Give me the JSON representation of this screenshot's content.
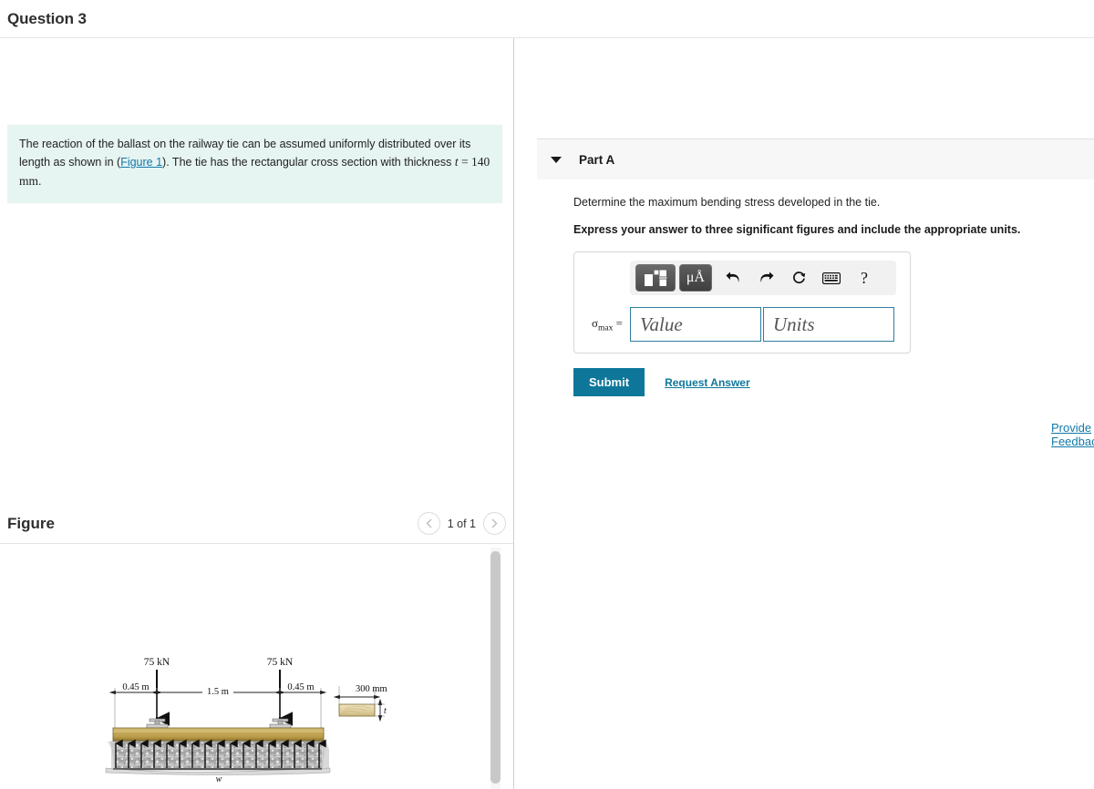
{
  "question": {
    "title": "Question 3"
  },
  "problem": {
    "text_part1": "The reaction of the ballast on the railway tie can be assumed uniformly distributed over its length as shown in (",
    "figure_link": "Figure 1",
    "text_part2": "). The tie has the rectangular cross section with thickness ",
    "thickness_var": "t",
    "thickness_eq": " = ",
    "thickness_value": "140 mm",
    "text_end": "."
  },
  "figure_panel": {
    "label": "Figure",
    "counter": "1 of 1",
    "prev_icon": "chevron-left-icon",
    "next_icon": "chevron-right-icon"
  },
  "figure_art": {
    "load_left_label": "75 kN",
    "load_right_label": "75 kN",
    "dim_left": "0.45 m",
    "dim_center": "1.5 m",
    "dim_right": "0.45 m",
    "distributed_load_label": "w",
    "section_width_label": "300 mm",
    "section_thickness_label": "t"
  },
  "part_a": {
    "caret_icon": "caret-down-icon",
    "label": "Part A",
    "prompt": "Determine the maximum bending stress developed in the tie.",
    "instruction": "Express your answer to three significant figures and include the appropriate units.",
    "toolbar": {
      "template_icon": "math-template-icon",
      "units_icon": "micro-angstrom-icon",
      "units_label": "μÅ",
      "undo_icon": "undo-arrow-icon",
      "redo_icon": "redo-arrow-icon",
      "reset_icon": "reset-circular-arrow-icon",
      "keyboard_icon": "keyboard-icon",
      "help_icon": "help-question-icon",
      "help_label": "?"
    },
    "answer": {
      "symbol_main": "σ",
      "symbol_sub": "max",
      "symbol_equals": "=",
      "value_placeholder": "Value",
      "units_placeholder": "Units",
      "value": "",
      "units": ""
    },
    "submit_label": "Submit",
    "request_answer_label": "Request Answer"
  },
  "footer": {
    "provide_feedback_label": "Provide Feedback"
  },
  "colors": {
    "accent": "#0e7799",
    "link": "#1279a8",
    "info_box": "#e6f4f2",
    "panel_header": "#f7f7f7",
    "input_border": "#2d7e9e"
  }
}
